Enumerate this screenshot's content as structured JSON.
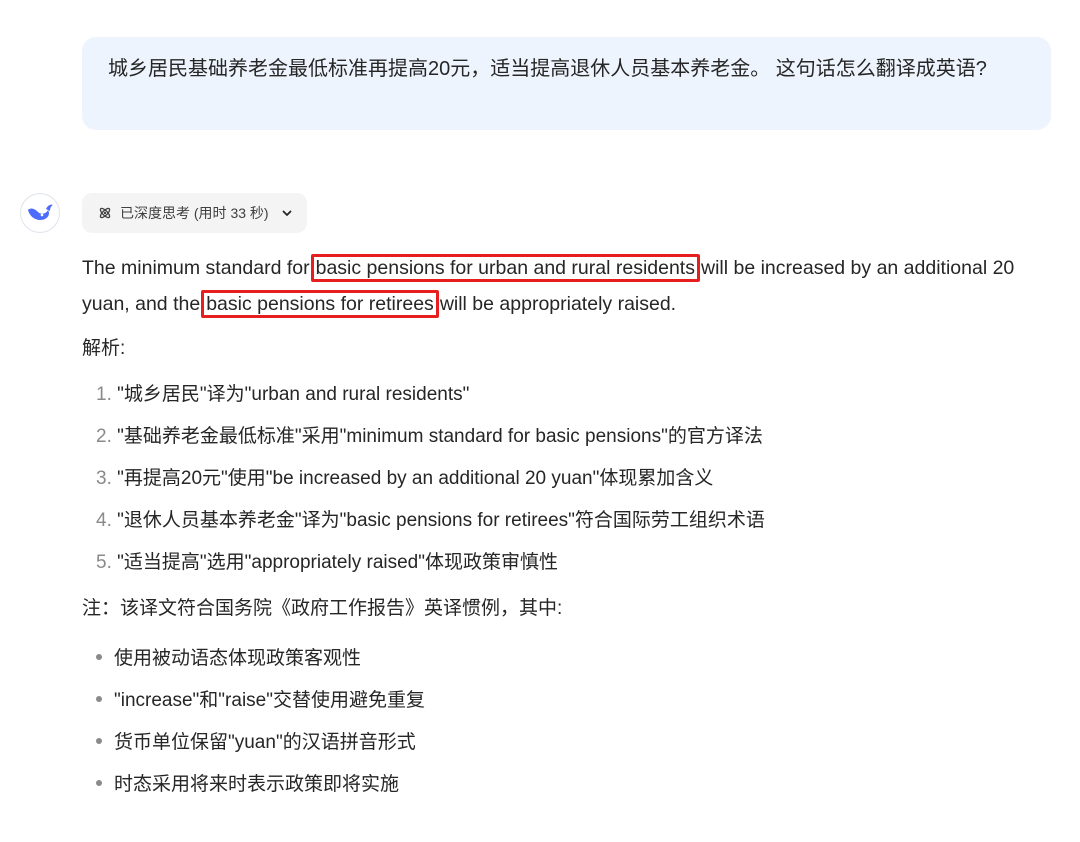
{
  "user_message": "城乡居民基础养老金最低标准再提高20元，适当提高退休人员基本养老金。 这句话怎么翻译成英语?",
  "assistant": {
    "avatar_icon": "deepseek-whale-icon",
    "think_chip": {
      "icon": "atom-icon",
      "label": "已深度思考 (用时 33 秒)",
      "chevron": "chevron-down-icon"
    },
    "translation": {
      "part1": "The minimum standard for",
      "hl1": "basic pensions for urban and rural residents",
      "part2": "will be increased by an additional 20 yuan, and the",
      "hl2": "basic pensions for retirees",
      "part3": "will be appropriately raised."
    },
    "analysis_label": "解析:",
    "analysis_points": [
      {
        "num": "1.",
        "text": "\"城乡居民\"译为\"urban and rural residents\""
      },
      {
        "num": "2.",
        "text": "\"基础养老金最低标准\"采用\"minimum standard for basic pensions\"的官方译法"
      },
      {
        "num": "3.",
        "text": "\"再提高20元\"使用\"be increased by an additional 20 yuan\"体现累加含义"
      },
      {
        "num": "4.",
        "text": "\"退休人员基本养老金\"译为\"basic pensions for retirees\"符合国际劳工组织术语"
      },
      {
        "num": "5.",
        "text": "\"适当提高\"选用\"appropriately raised\"体现政策审慎性"
      }
    ],
    "note": "注：该译文符合国务院《政府工作报告》英译惯例，其中:",
    "notes_bullets": [
      "使用被动语态体现政策客观性",
      "\"increase\"和\"raise\"交替使用避免重复",
      "货币单位保留\"yuan\"的汉语拼音形式",
      "时态采用将来时表示政策即将实施"
    ]
  },
  "colors": {
    "user_bubble_bg": "#eef4fd",
    "highlight_border": "#e61e1e",
    "brand_blue": "#4d6bfe"
  }
}
